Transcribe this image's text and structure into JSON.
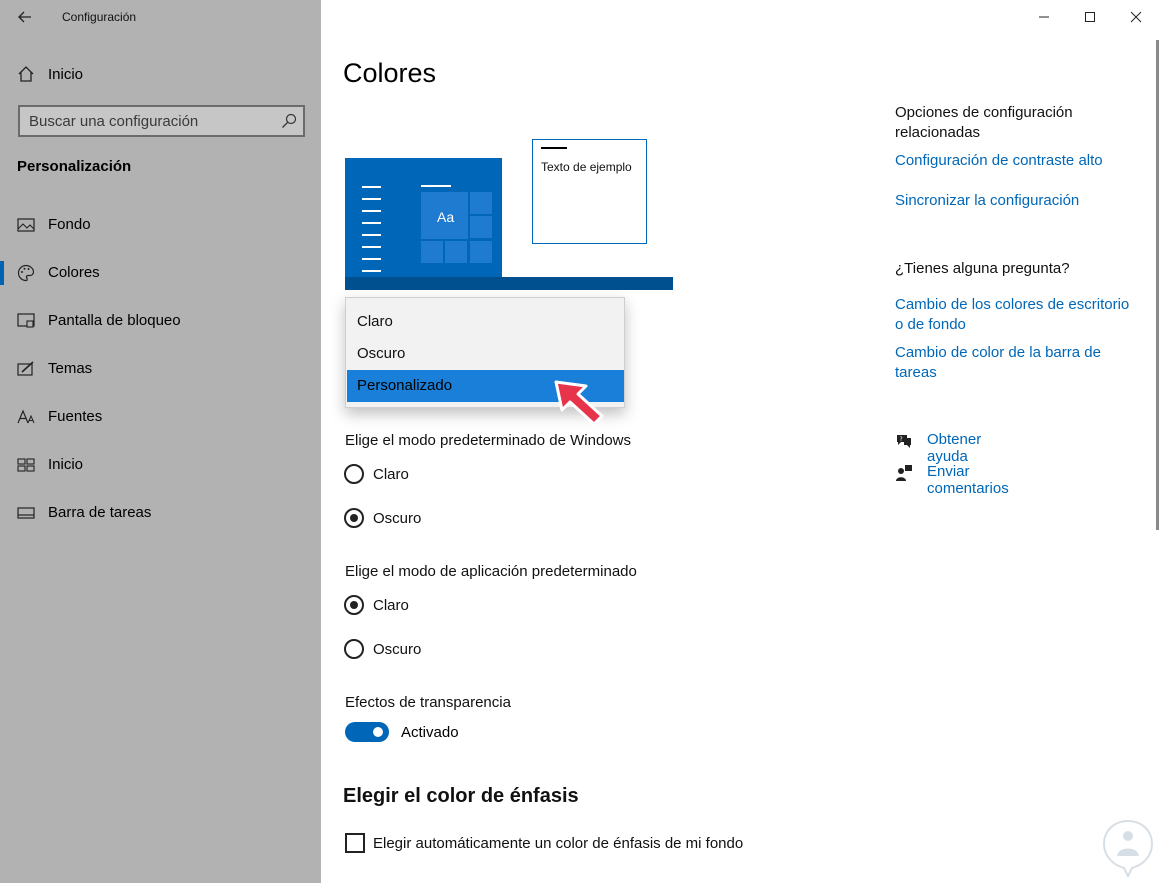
{
  "window": {
    "app_title": "Configuración",
    "controls": [
      "minimize-icon",
      "maximize-icon",
      "close-icon"
    ]
  },
  "sidebar": {
    "home_label": "Inicio",
    "search_placeholder": "Buscar una configuración",
    "section_title": "Personalización",
    "items": [
      {
        "label": "Fondo",
        "icon": "picture-icon",
        "selected": false
      },
      {
        "label": "Colores",
        "icon": "palette-icon",
        "selected": true
      },
      {
        "label": "Pantalla de bloqueo",
        "icon": "lock-screen-icon",
        "selected": false
      },
      {
        "label": "Temas",
        "icon": "brush-icon",
        "selected": false
      },
      {
        "label": "Fuentes",
        "icon": "font-icon",
        "selected": false
      },
      {
        "label": "Inicio",
        "icon": "start-icon",
        "selected": false
      },
      {
        "label": "Barra de tareas",
        "icon": "taskbar-icon",
        "selected": false
      }
    ]
  },
  "main": {
    "title": "Colores",
    "preview": {
      "sample_text": "Texto de ejemplo",
      "tile_text": "Aa"
    },
    "color_dropdown": {
      "options": [
        "Claro",
        "Oscuro",
        "Personalizado"
      ],
      "selected": "Personalizado"
    },
    "windows_mode": {
      "label": "Elige el modo predeterminado de Windows",
      "options": [
        "Claro",
        "Oscuro"
      ],
      "selected": "Oscuro"
    },
    "app_mode": {
      "label": "Elige el modo de aplicación predeterminado",
      "options": [
        "Claro",
        "Oscuro"
      ],
      "selected": "Claro"
    },
    "transparency": {
      "label": "Efectos de transparencia",
      "state_label": "Activado",
      "on": true
    },
    "accent": {
      "heading": "Elegir el color de énfasis",
      "auto_checkbox_label": "Elegir automáticamente un color de énfasis de mi fondo",
      "auto_checked": false
    }
  },
  "related": {
    "heading": "Opciones de configuración relacionadas",
    "links": [
      "Configuración de contraste alto",
      "Sincronizar la configuración"
    ]
  },
  "questions": {
    "heading": "¿Tienes alguna pregunta?",
    "links": [
      "Cambio de los colores de escritorio o de fondo",
      "Cambio de color de la barra de tareas"
    ]
  },
  "help": {
    "get_help": "Obtener ayuda",
    "feedback": "Enviar comentarios"
  },
  "colors": {
    "accent": "#0067b8",
    "sidebar_bg": "#b2b2b2",
    "link": "#0067b8",
    "dropdown_selected": "#1a7fd9"
  }
}
